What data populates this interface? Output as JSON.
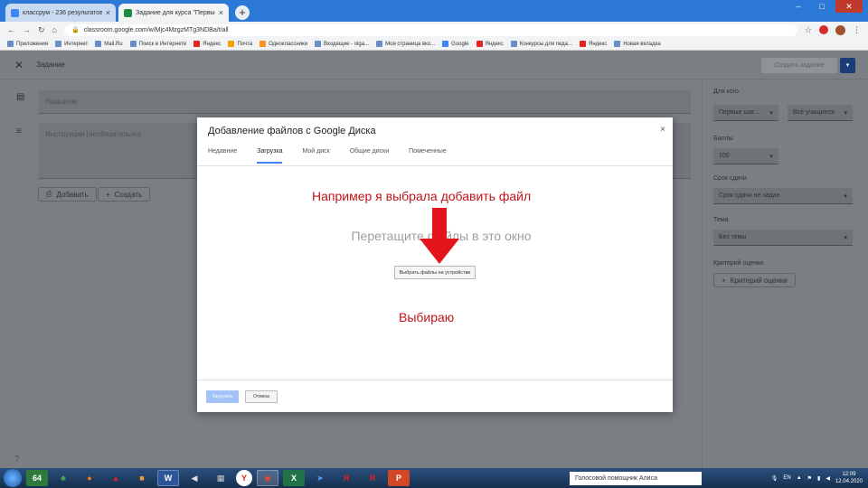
{
  "browser": {
    "tabs": [
      {
        "title": "классрум - 236 результатов. По",
        "icon": "g-icon",
        "color": "#4285f4",
        "active": false
      },
      {
        "title": "Задание для курса \"Первые ша",
        "icon": "classroom-icon",
        "color": "#1e8e3e",
        "active": true
      }
    ],
    "url": "classroom.google.com/w/Mjc4MzgzMTg3NDBa/t/all",
    "bookmarks": [
      "Приложения",
      "Интернет",
      "Mail.Ru",
      "Поиск в Интернете",
      "Яндекс",
      "Почта",
      "Одноклассники",
      "Входящие - olga...",
      "Моя страница вко...",
      "Google",
      "Яндекс",
      "Конкурсы для педа...",
      "Яндекс",
      "Новая вкладка"
    ]
  },
  "page": {
    "header_title": "Задание",
    "assign_button": "Создать задание",
    "title_placeholder": "Название",
    "instructions_placeholder": "Инструкции (необязательно)",
    "add_button": "Добавить",
    "create_button": "Создать",
    "side": {
      "for_label": "Для кого",
      "for_value": "Первые шаг...",
      "students_value": "Все учащиеся",
      "points_label": "Баллы",
      "points_value": "100",
      "due_label": "Срок сдачи",
      "due_value": "Срок сдачи не задан",
      "topic_label": "Тема",
      "topic_value": "Без темы",
      "rubric_label": "Критерий оценки",
      "rubric_button": "Критерий оценки"
    },
    "help_icon": "?"
  },
  "modal": {
    "title": "Добавление файлов с Google Диска",
    "close_icon": "×",
    "tabs": [
      "Недавние",
      "Загрузка",
      "Мой диск",
      "Общие диски",
      "Помеченные"
    ],
    "active_tab": 1,
    "drop_text": "Перетащите файлы в это окно",
    "choose_button": "Выбрать файлы на устройстве",
    "upload_button": "Загрузить",
    "cancel_button": "Отмена"
  },
  "annotations": {
    "top": "Например я выбрала добавить файл",
    "bottom": "Выбираю",
    "color": "#c0141a"
  },
  "taskbar": {
    "apps": [
      "64",
      "",
      "",
      "",
      "",
      "W",
      "",
      "",
      "Y",
      "",
      "X",
      "",
      "Я",
      "Я",
      "P"
    ],
    "assistant": "Голосовой помощник Алиса",
    "lang": "EN",
    "time": "12:09",
    "date": "12.04.2020"
  }
}
